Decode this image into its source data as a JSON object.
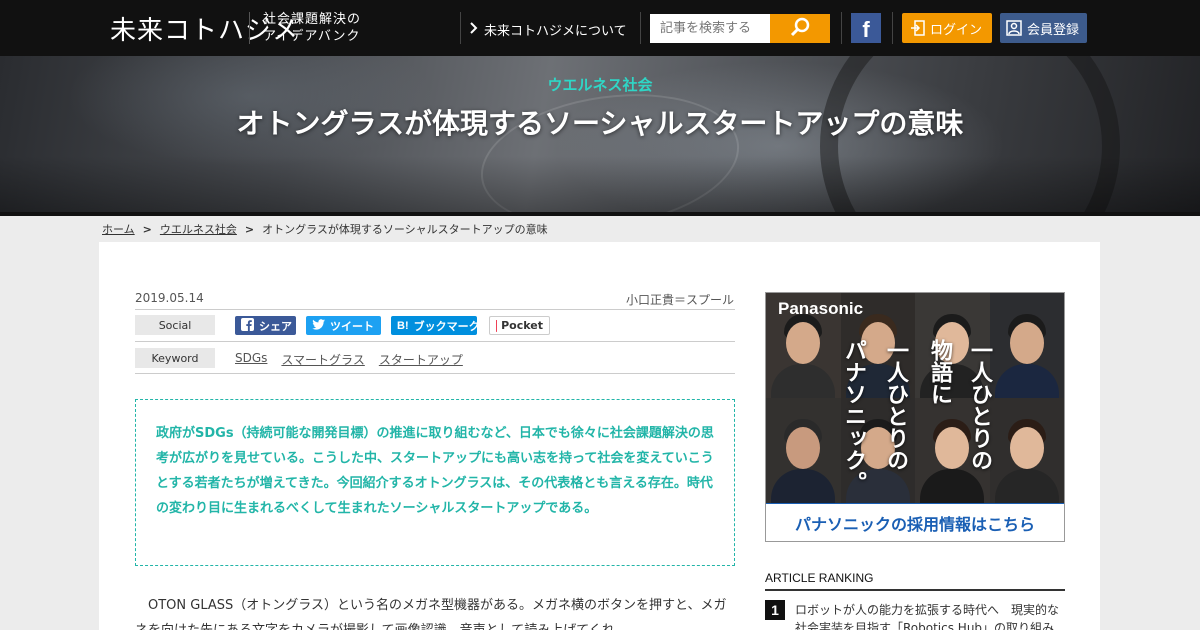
{
  "header": {
    "logo": "未来コトハジメ",
    "tagline_line1": "社会課題解決の",
    "tagline_line2": "アイデアバンク",
    "about_link": "未来コトハジメについて",
    "search_placeholder": "記事を検索する",
    "facebook_label": "f",
    "login_label": "ログイン",
    "register_label": "会員登録"
  },
  "hero": {
    "category": "ウエルネス社会",
    "title": "オトングラスが体現するソーシャルスタートアップの意味"
  },
  "breadcrumb": {
    "home": "ホーム",
    "category": "ウエルネス社会",
    "current": "オトングラスが体現するソーシャルスタートアップの意味"
  },
  "article": {
    "date": "2019.05.14",
    "author": "小口正貴＝スプール",
    "social_label": "Social",
    "keyword_label": "Keyword",
    "share": {
      "facebook": "シェア",
      "twitter": "ツイート",
      "hatena_icon": "B!",
      "hatena": "ブックマーク",
      "pocket": "Pocket"
    },
    "keywords": [
      "SDGs",
      "スマートグラス",
      "スタートアップ"
    ],
    "lead": "政府がSDGs（持続可能な開発目標）の推進に取り組むなど、日本でも徐々に社会課題解決の思考が広がりを見せている。こうした中、スタートアップにも高い志を持って社会を変えていこうとする若者たちが増えてきた。今回紹介するオトングラスは、その代表格とも言える存在。時代の変わり目に生まれるべくして生まれたソーシャルスタートアップである。",
    "body": "OTON GLASS（オトングラス）という名のメガネ型機器がある。メガネ横のボタンを押すと、メガネを向けた先にある文字をカメラが撮影して画像認識、音声として読み上げてくれ"
  },
  "sidebar": {
    "ad": {
      "brand": "Panasonic",
      "vertical_col1": "一人ひとりの",
      "vertical_col2": "物語に",
      "vertical_col3": "一人ひとりの",
      "vertical_col4": "パナソニック。",
      "footer": "パナソニックの採用情報はこちら"
    },
    "ranking_title": "ARTICLE RANKING",
    "ranking": [
      {
        "rank": "1",
        "title": "ロボットが人の能力を拡張する時代へ　現実的な社会実装を目指す「Robotics Hub」の取り組み"
      }
    ]
  },
  "colors": {
    "accent_orange": "#f39800",
    "teal": "#22b5a8",
    "facebook_blue": "#3b5998",
    "twitter_blue": "#1da1f2",
    "hatena_blue": "#008fde",
    "register_blue": "#3d5b8c"
  },
  "icons": [
    "chevron-right-icon",
    "search-icon",
    "facebook-icon",
    "login-icon",
    "user-icon",
    "pocket-icon"
  ]
}
